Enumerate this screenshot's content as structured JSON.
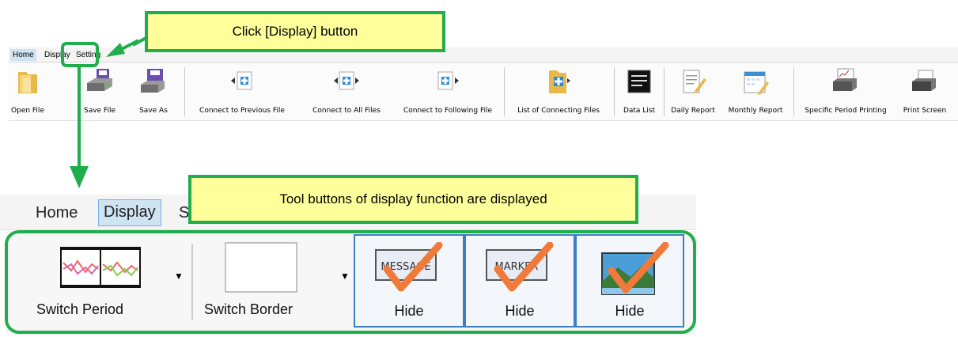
{
  "colors": {
    "accent_green": "#1fae4b",
    "callout_fill": "#ffff9b",
    "selected_tab": "#cfe4f3",
    "hide_border": "#3d7ec6"
  },
  "callout_top": "Click [Display] button",
  "callout_bottom": "Tool buttons of display function are displayed",
  "small_ribbon": {
    "tabs": [
      "Home",
      "Display",
      "Setting"
    ],
    "buttons": [
      {
        "label": "Open File",
        "icon": "folder-icon"
      },
      {
        "label": "Save File",
        "icon": "save-disk-icon"
      },
      {
        "label": "Save As",
        "icon": "save-as-icon"
      },
      {
        "label": "Connect to Previous File",
        "icon": "connect-previous-icon"
      },
      {
        "label": "Connect to All Files",
        "icon": "connect-all-icon"
      },
      {
        "label": "Connect to Following File",
        "icon": "connect-following-icon"
      },
      {
        "label": "List of Connecting Files",
        "icon": "connecting-files-list-icon"
      },
      {
        "label": "Data List",
        "icon": "data-list-icon"
      },
      {
        "label": "Daily Report",
        "icon": "daily-report-icon"
      },
      {
        "label": "Monthly Report",
        "icon": "monthly-report-icon"
      },
      {
        "label": "Specific Period Printing",
        "icon": "printer-icon"
      },
      {
        "label": "Print Screen",
        "icon": "printer-icon"
      }
    ]
  },
  "big_ribbon": {
    "tabs": [
      "Home",
      "Display",
      "S"
    ],
    "buttons": [
      {
        "label": "Switch Period",
        "icon": "switch-period-icon"
      },
      {
        "label": "Switch Border",
        "icon": "switch-border-icon"
      },
      {
        "label": "Hide",
        "icon": "hide-message-icon",
        "badge": "MESSAGE"
      },
      {
        "label": "Hide",
        "icon": "hide-marker-icon",
        "badge": "MARKER"
      },
      {
        "label": "Hide",
        "icon": "hide-image-icon"
      }
    ]
  }
}
